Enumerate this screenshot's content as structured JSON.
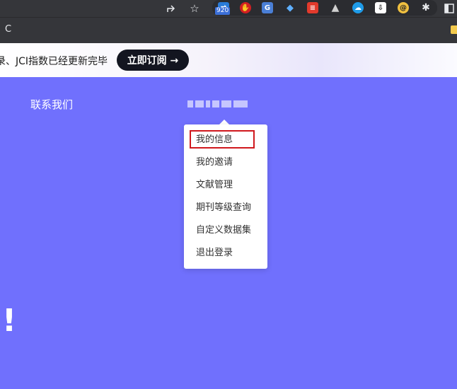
{
  "browser": {
    "extension_badge": "920",
    "bookmark_label": "C"
  },
  "banner": {
    "text": "录、JCI指数已经更新完毕",
    "subscribe_button": "立即订阅 →"
  },
  "header": {
    "contact_label": "联系我们",
    "username_masked": "********"
  },
  "user_menu": {
    "items": [
      {
        "label": "我的信息"
      },
      {
        "label": "我的邀请"
      },
      {
        "label": "文献管理"
      },
      {
        "label": "期刊等级查询"
      },
      {
        "label": "自定义数据集"
      },
      {
        "label": "退出登录"
      }
    ],
    "highlighted_index": 0,
    "highlight_color": "#d0181d"
  },
  "hero": {
    "exclamation": "!"
  },
  "colors": {
    "page_background": "#7070fd",
    "toolbar": "#35363a",
    "subscribe_button": "#131520"
  }
}
